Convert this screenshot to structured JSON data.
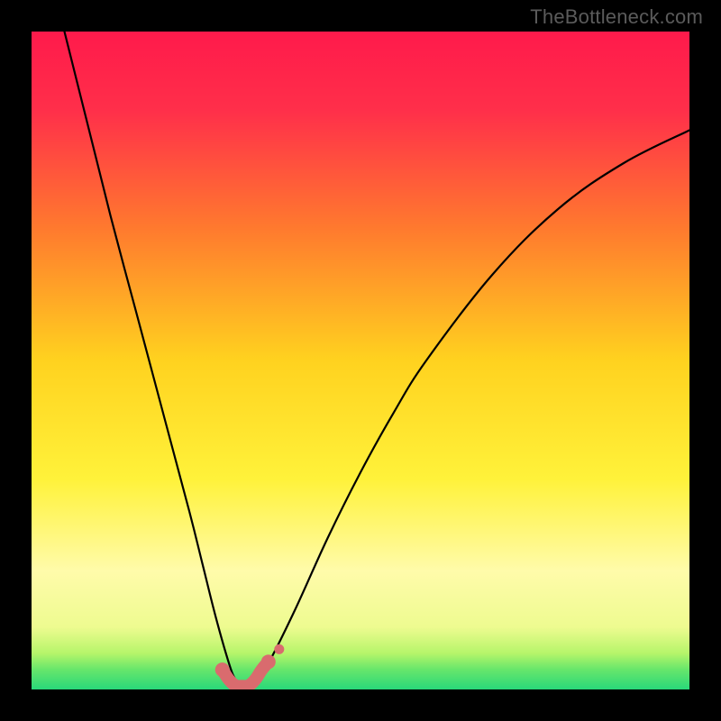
{
  "watermark": "TheBottleneck.com",
  "chart_data": {
    "type": "line",
    "title": "",
    "xlabel": "",
    "ylabel": "",
    "xlim": [
      0,
      100
    ],
    "ylim": [
      0,
      100
    ],
    "series": [
      {
        "name": "bottleneck-curve",
        "x": [
          5,
          8,
          12,
          16,
          20,
          24,
          26,
          28,
          30,
          31,
          32,
          33,
          34,
          36,
          40,
          45,
          50,
          55,
          60,
          70,
          80,
          90,
          100
        ],
        "y": [
          100,
          88,
          72,
          57,
          42,
          27,
          19,
          11,
          4,
          1.5,
          0.5,
          0.5,
          1.5,
          4,
          12,
          23,
          33,
          42,
          50,
          63,
          73,
          80,
          85
        ]
      },
      {
        "name": "highlight-bottom",
        "x": [
          29,
          30,
          31,
          32,
          33,
          34,
          35,
          36
        ],
        "y": [
          3.0,
          1.5,
          0.6,
          0.5,
          0.6,
          1.5,
          3.0,
          4.2
        ]
      }
    ],
    "gradient_stops": [
      {
        "offset": 0.0,
        "color": "#ff1a4b"
      },
      {
        "offset": 0.12,
        "color": "#ff2f4a"
      },
      {
        "offset": 0.3,
        "color": "#ff7a2e"
      },
      {
        "offset": 0.5,
        "color": "#ffd21f"
      },
      {
        "offset": 0.68,
        "color": "#fff23a"
      },
      {
        "offset": 0.82,
        "color": "#fffbaa"
      },
      {
        "offset": 0.905,
        "color": "#eefb90"
      },
      {
        "offset": 0.945,
        "color": "#b6f56a"
      },
      {
        "offset": 0.97,
        "color": "#66e66b"
      },
      {
        "offset": 1.0,
        "color": "#29d87a"
      }
    ],
    "highlight_color": "#d96b6e",
    "curve_color": "#000000"
  }
}
